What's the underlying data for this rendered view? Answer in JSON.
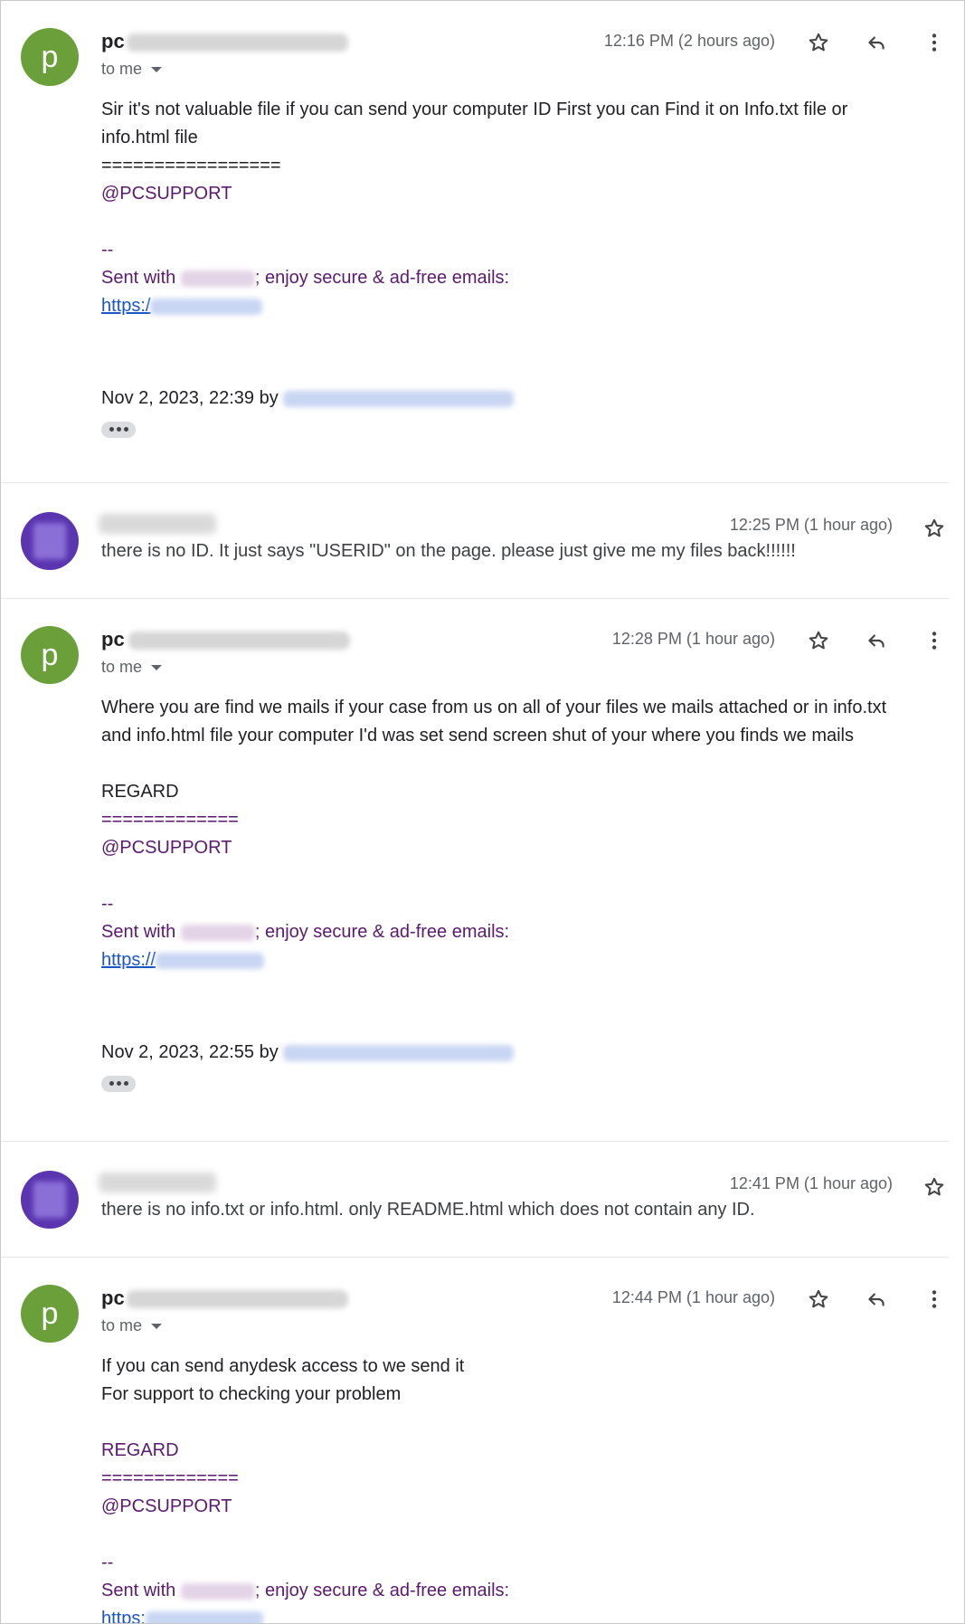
{
  "messages": [
    {
      "sender_initial": "p",
      "sender": "pc",
      "to": "to me",
      "time": "12:16 PM (2 hours ago)",
      "body": {
        "p1": "Sir it's not valuable file if you can send your computer ID First you can Find it on Info.txt file or",
        "p2": "info.html file",
        "sep": "=================",
        "sig": "@PCSUPPORT",
        "dash": "--",
        "sent_with": "Sent with",
        "sent_rest": "; enjoy secure & ad-free emails:",
        "link_prefix": "https:/",
        "quote_line": "Nov 2, 2023, 22:39 by"
      }
    },
    {
      "collapsed": true,
      "time": "12:25 PM (1 hour ago)",
      "snippet": "there is no ID. It just says \"USERID\" on the page. please just give me my files back!!!!!!"
    },
    {
      "sender_initial": "p",
      "sender": "pc",
      "to": "to me",
      "time": "12:28 PM (1 hour ago)",
      "body": {
        "p1": "Where you are find we mails if your case from us on all of your files we mails attached or in info.txt",
        "p2": "and info.html file your computer I'd was set  send screen shut of your where you finds we mails",
        "regard": "REGARD",
        "sep": "=============",
        "sig": "@PCSUPPORT",
        "dash": "--",
        "sent_with": "Sent with",
        "sent_rest": "; enjoy secure & ad-free emails:",
        "link_prefix": "https://",
        "quote_line": "Nov 2, 2023, 22:55 by"
      }
    },
    {
      "collapsed": true,
      "time": "12:41 PM (1 hour ago)",
      "snippet": "there is no info.txt or info.html. only README.html which does not contain any ID."
    },
    {
      "sender_initial": "p",
      "sender": "pc",
      "to": "to me",
      "time": "12:44 PM (1 hour ago)",
      "body": {
        "p1": "If you can send anydesk access to we send it",
        "p2": "For support to checking your problem",
        "regard": "REGARD",
        "sep": "=============",
        "sig": "@PCSUPPORT",
        "dash": "--",
        "sent_with": "Sent with",
        "sent_rest": "; enjoy secure & ad-free emails:",
        "link_prefix": "https:"
      }
    }
  ],
  "icons": {
    "star": "star-outline-icon",
    "reply": "reply-icon",
    "more": "more-vertical-icon",
    "caret": "chevron-down-icon"
  },
  "colors": {
    "avatar_green": "#6a9f3a",
    "avatar_purple": "#5b35b0",
    "signature_purple": "#5a1a6e",
    "link_blue": "#1a56c7"
  }
}
